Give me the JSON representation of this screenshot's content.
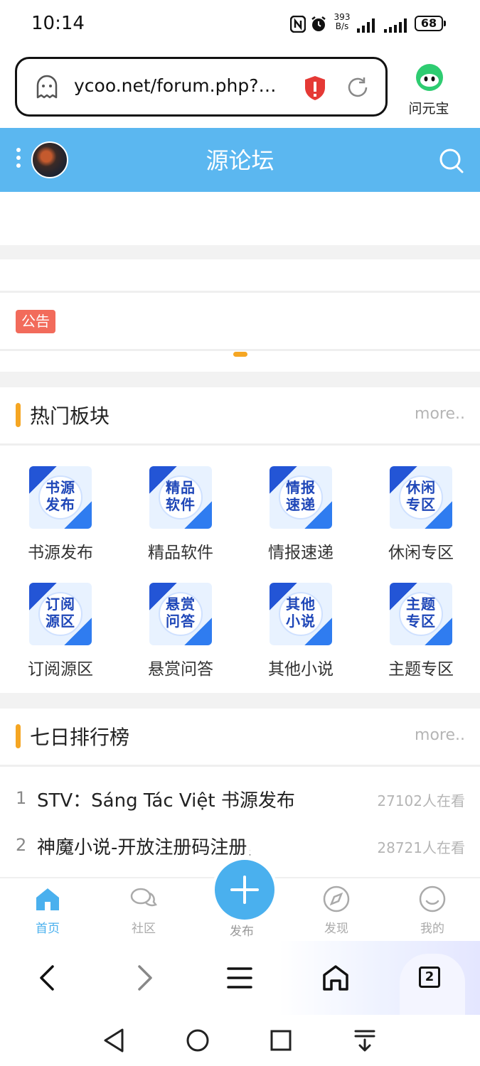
{
  "status_bar": {
    "time": "10:14",
    "net_speed_value": "393",
    "net_speed_unit": "B/s",
    "battery": "68",
    "icons": [
      "nfc-icon",
      "alarm-icon",
      "signal-icon",
      "signal-icon"
    ]
  },
  "browser": {
    "url": "ycoo.net/forum.php?m...",
    "assistant_label": "问元宝",
    "tab_count": "2",
    "icons": [
      "ghost-icon",
      "shield-icon",
      "refresh-icon"
    ]
  },
  "site": {
    "title": "源论坛",
    "notice_badge": "公告",
    "header_color": "#5bb7f0",
    "accent_color": "#f5a623"
  },
  "hot_boards": {
    "title": "热门板块",
    "more": "more..",
    "items": [
      {
        "label": "书源发布",
        "icon_line1": "书源",
        "icon_line2": "发布"
      },
      {
        "label": "精品软件",
        "icon_line1": "精品",
        "icon_line2": "软件"
      },
      {
        "label": "情报速递",
        "icon_line1": "情报",
        "icon_line2": "速递"
      },
      {
        "label": "休闲专区",
        "icon_line1": "休闲",
        "icon_line2": "专区"
      },
      {
        "label": "订阅源区",
        "icon_line1": "订阅",
        "icon_line2": "源区"
      },
      {
        "label": "悬赏问答",
        "icon_line1": "悬赏",
        "icon_line2": "问答"
      },
      {
        "label": "其他小说",
        "icon_line1": "其他",
        "icon_line2": "小说"
      },
      {
        "label": "主题专区",
        "icon_line1": "主题",
        "icon_line2": "专区"
      }
    ]
  },
  "ranking": {
    "title": "七日排行榜",
    "more": "more..",
    "items": [
      {
        "rank": "1",
        "title": "STV：Sáng Tác Việt 书源发布",
        "views": "27102人在看"
      },
      {
        "rank": "2",
        "title": "神魔小说-开放注册码注册，和论坛",
        "views": "28721人在看"
      }
    ]
  },
  "tabbar": {
    "home": "首页",
    "community": "社区",
    "publish": "发布",
    "discover": "发现",
    "mine": "我的",
    "active_color": "#4ab0ee"
  }
}
